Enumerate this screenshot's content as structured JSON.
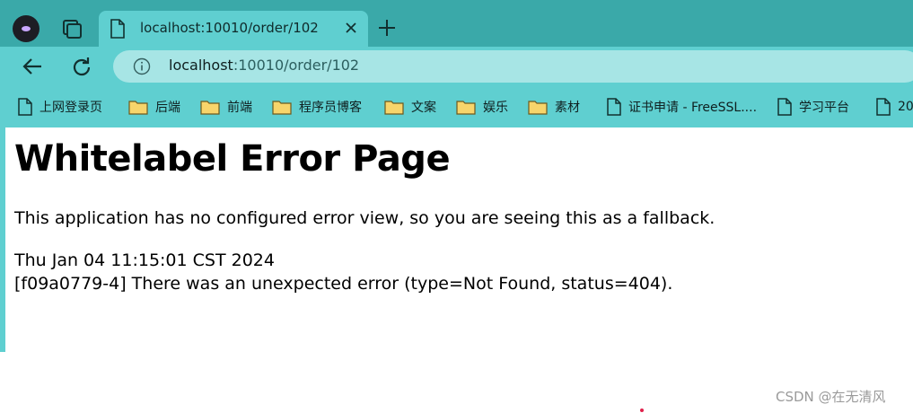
{
  "browser": {
    "tab": {
      "title": "localhost:10010/order/102"
    },
    "address_bar": {
      "host": "localhost",
      "rest": ":10010/order/102"
    },
    "bookmarks": [
      {
        "label": "上网登录页",
        "icon": "page-icon"
      },
      {
        "label": "后端",
        "icon": "folder-icon"
      },
      {
        "label": "前端",
        "icon": "folder-icon"
      },
      {
        "label": "程序员博客",
        "icon": "folder-icon"
      },
      {
        "label": "文案",
        "icon": "folder-icon"
      },
      {
        "label": "娱乐",
        "icon": "folder-icon"
      },
      {
        "label": "素材",
        "icon": "folder-icon"
      },
      {
        "label": "证书申请 - FreeSSL....",
        "icon": "page-icon"
      },
      {
        "label": "学习平台",
        "icon": "page-icon"
      },
      {
        "label": "20",
        "icon": "page-icon"
      }
    ],
    "colors": {
      "tabstrip": "#3aa9a9",
      "toolbar": "#5fcfd0",
      "omnibox": "#a7e5e5"
    }
  },
  "page": {
    "title": "Whitelabel Error Page",
    "description": "This application has no configured error view, so you are seeing this as a fallback.",
    "timestamp": "Thu Jan 04 11:15:01 CST 2024",
    "message": "[f09a0779-4] There was an unexpected error (type=Not Found, status=404)."
  },
  "watermark": "CSDN @在无清风"
}
